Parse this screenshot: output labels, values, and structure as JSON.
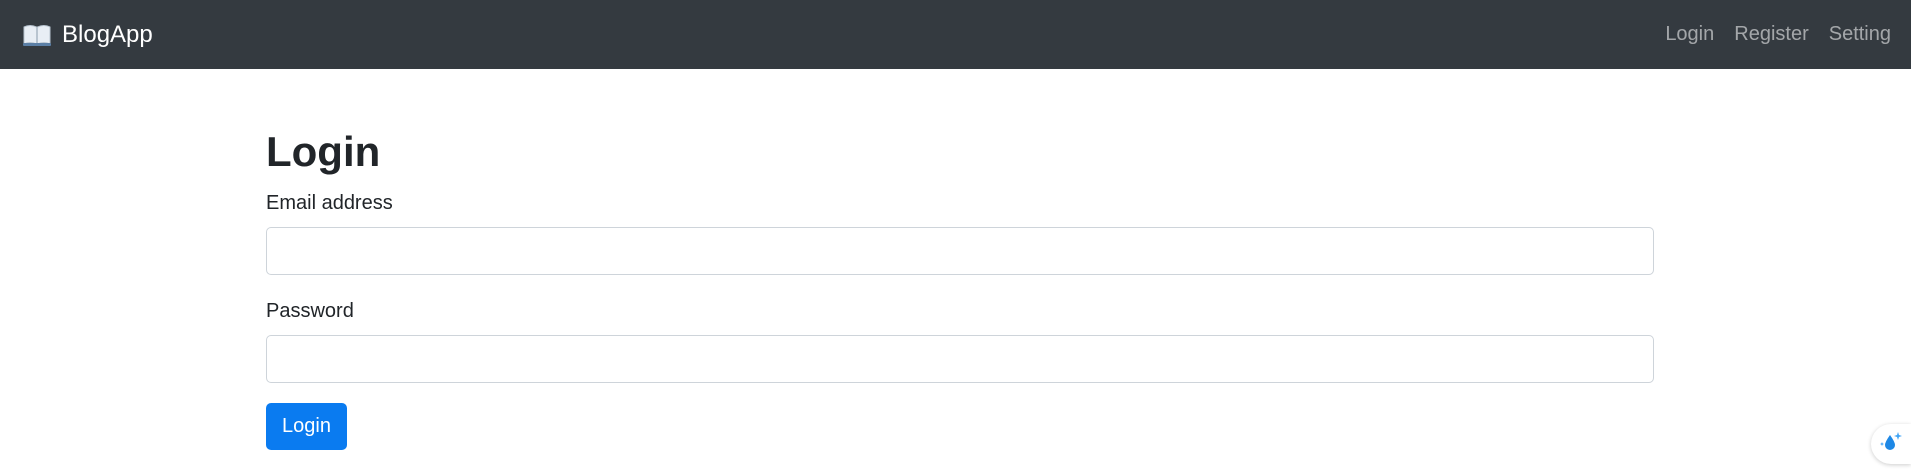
{
  "navbar": {
    "brand_icon": "open-book-icon",
    "brand_label": "BlogApp",
    "links": [
      {
        "label": "Login"
      },
      {
        "label": "Register"
      },
      {
        "label": "Setting"
      }
    ]
  },
  "main": {
    "title": "Login",
    "email_label": "Email address",
    "email_value": "",
    "password_label": "Password",
    "password_value": "",
    "submit_label": "Login"
  },
  "extension": {
    "icon": "water-drop-sparkle-icon"
  },
  "colors": {
    "navbar_bg": "#343a40",
    "primary": "#0a7bf0",
    "nav_link": "rgba(255,255,255,0.55)"
  }
}
